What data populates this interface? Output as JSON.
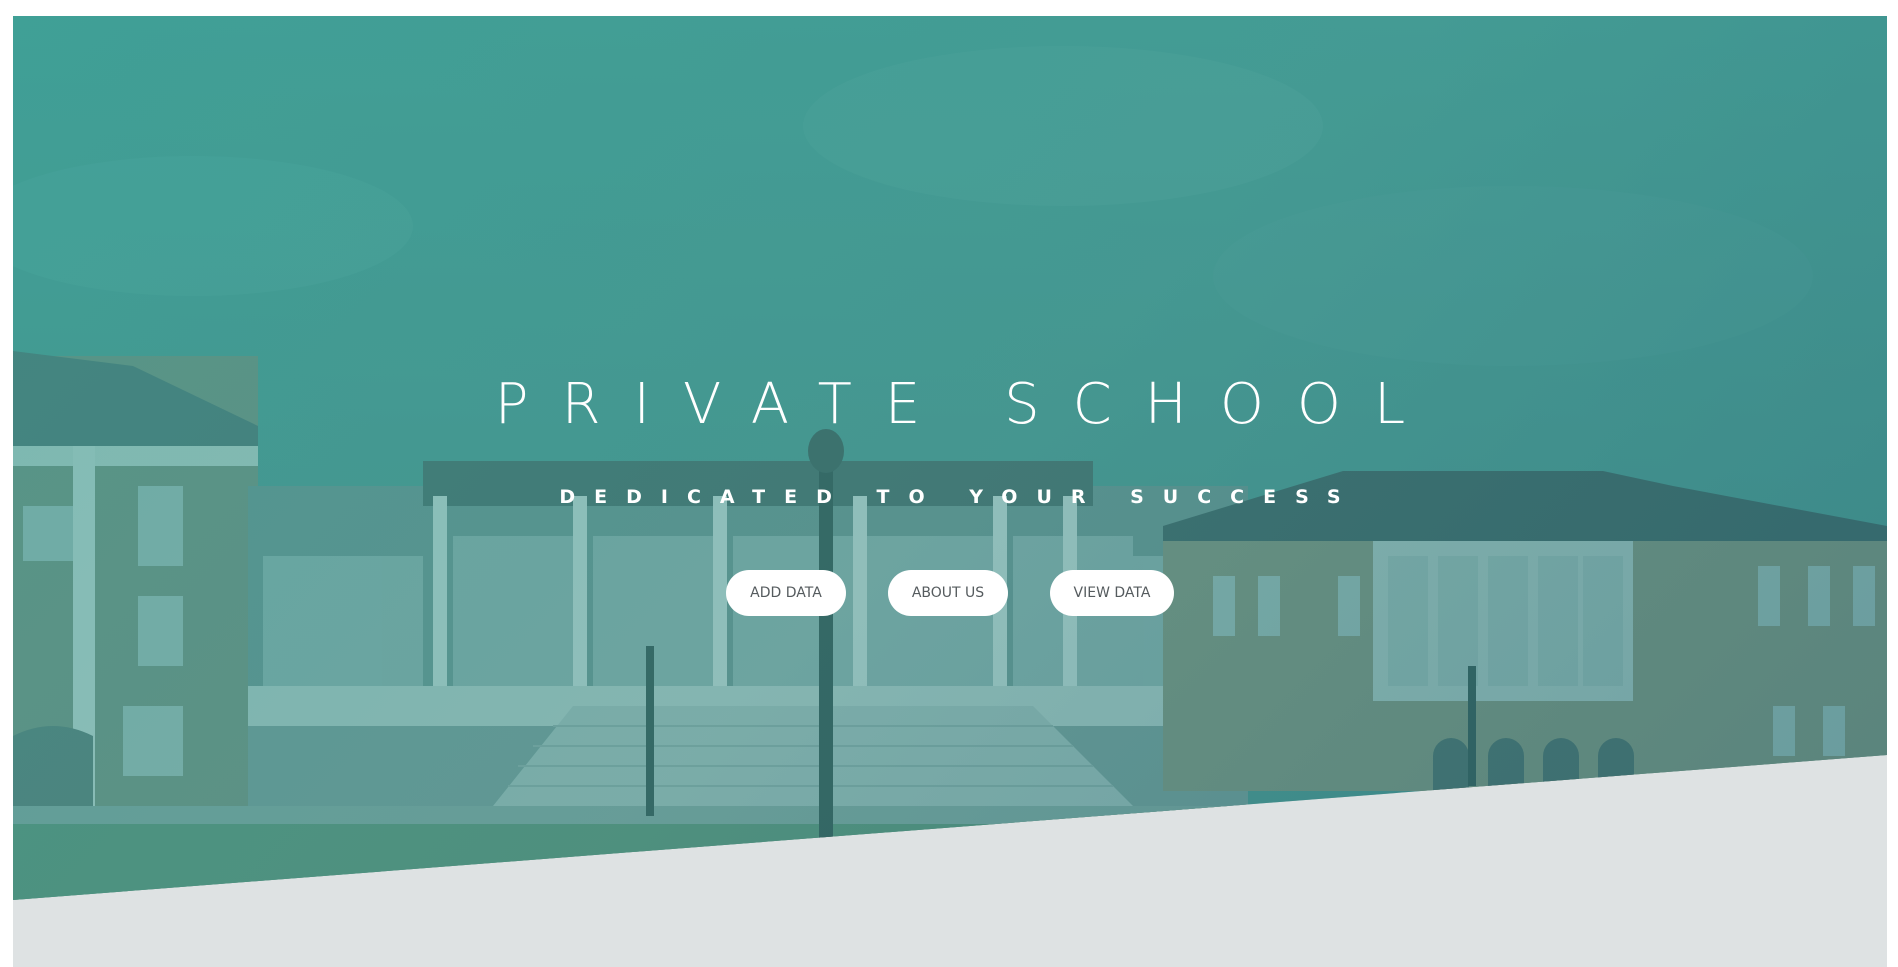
{
  "hero": {
    "title": "PRIVATE SCHOOL",
    "subtitle": "DEDICATED TO YOUR SUCCESS",
    "buttons": {
      "add_data": "ADD DATA",
      "about_us": "ABOUT US",
      "view_data": "VIEW DATA"
    },
    "background_image": "campus-building-photo",
    "overlay_color": "#3fa095",
    "lower_band_color": "#dee2e3"
  }
}
